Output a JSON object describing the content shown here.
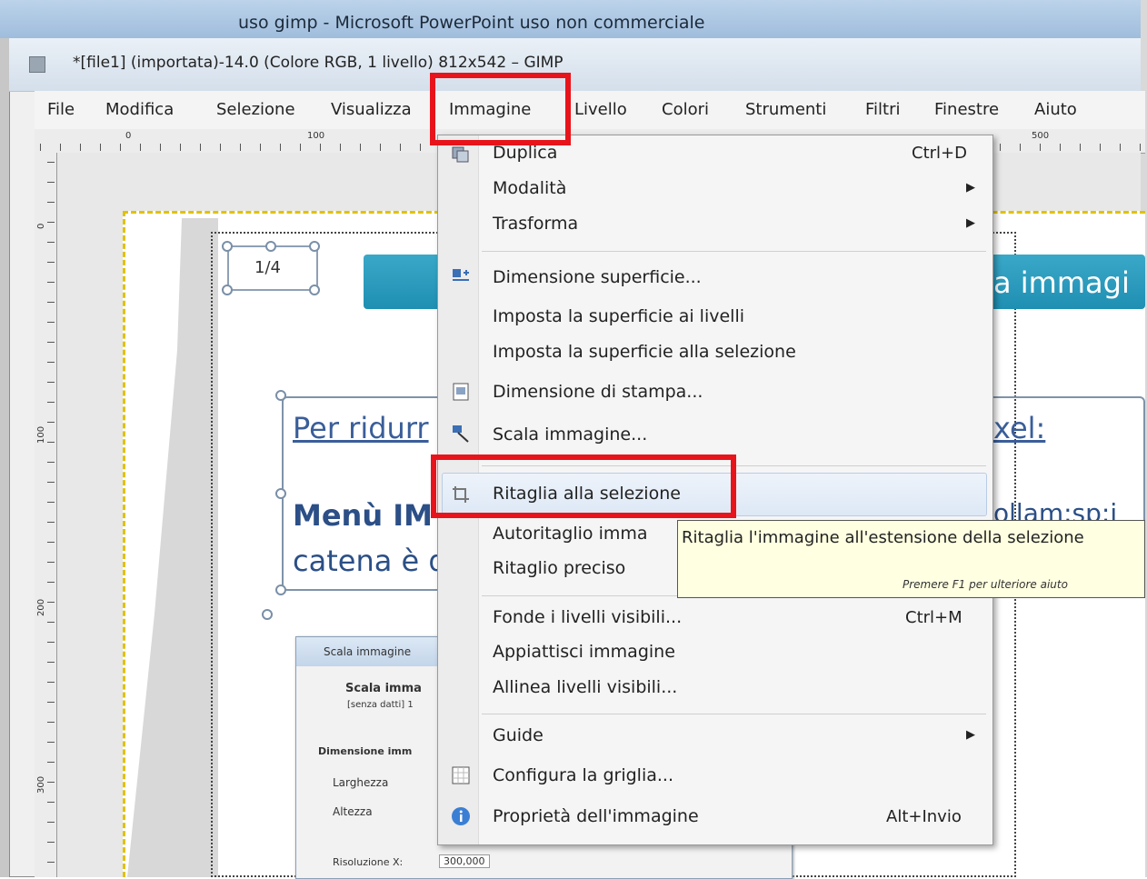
{
  "outer_window": {
    "title": "uso gimp - Microsoft PowerPoint uso non commerciale"
  },
  "gimp_window": {
    "title": "*[file1] (importata)-14.0 (Colore RGB, 1 livello) 812x542 – GIMP"
  },
  "menubar": {
    "items": [
      "File",
      "Modifica",
      "Selezione",
      "Visualizza",
      "Immagine",
      "Livello",
      "Colori",
      "Strumenti",
      "Filtri",
      "Finestre",
      "Aiuto"
    ],
    "active": "Immagine"
  },
  "rulers": {
    "top_labels": [
      "0",
      "100",
      "500"
    ],
    "left_labels": [
      "0",
      "100",
      "200",
      "300"
    ]
  },
  "slide": {
    "page_number": "1/4",
    "title_fragment": "a immagi",
    "line1_start": "Per ridurr",
    "line1_end": "xel:",
    "line2_start": "Menù IM",
    "line2_end": "ollam:sp:i",
    "line3_start": "catena è d"
  },
  "mini_dialog": {
    "title": "Scala immagine",
    "header": "Scala imma",
    "subheader": "[senza datti] 1",
    "section": "Dimensione imm",
    "width_label": "Larghezza",
    "height_label": "Altezza",
    "resolution_label": "Risoluzione X:",
    "resolution_value": "300,000"
  },
  "dropdown": {
    "items": [
      {
        "label": "Duplica",
        "shortcut": "Ctrl+D",
        "submenu": false
      },
      {
        "label": "Modalità",
        "shortcut": "",
        "submenu": true
      },
      {
        "label": "Trasforma",
        "shortcut": "",
        "submenu": true
      },
      {
        "label": "Dimensione superficie...",
        "shortcut": "",
        "submenu": false
      },
      {
        "label": "Imposta la superficie ai livelli",
        "shortcut": "",
        "submenu": false
      },
      {
        "label": "Imposta la superficie alla selezione",
        "shortcut": "",
        "submenu": false
      },
      {
        "label": "Dimensione di stampa...",
        "shortcut": "",
        "submenu": false
      },
      {
        "label": "Scala immagine...",
        "shortcut": "",
        "submenu": false
      },
      {
        "label": "Ritaglia alla selezione",
        "shortcut": "",
        "submenu": false
      },
      {
        "label": "Autoritaglio imma",
        "shortcut": "",
        "submenu": false
      },
      {
        "label": "Ritaglio preciso",
        "shortcut": "",
        "submenu": false
      },
      {
        "label": "Fonde i livelli visibili...",
        "shortcut": "Ctrl+M",
        "submenu": false
      },
      {
        "label": "Appiattisci immagine",
        "shortcut": "",
        "submenu": false
      },
      {
        "label": "Allinea livelli visibili...",
        "shortcut": "",
        "submenu": false
      },
      {
        "label": "Guide",
        "shortcut": "",
        "submenu": true
      },
      {
        "label": "Configura la griglia...",
        "shortcut": "",
        "submenu": false
      },
      {
        "label": "Proprietà dell'immagine",
        "shortcut": "Alt+Invio",
        "submenu": false
      }
    ],
    "highlighted": "Ritaglia alla selezione"
  },
  "tooltip": {
    "text": "Ritaglia l'immagine all'estensione della selezione",
    "hint": "Premere F1 per ulteriore aiuto"
  },
  "colors": {
    "annotation_red": "#e8141b",
    "slide_teal": "#2a9bbd",
    "selection_yellow": "#e0c200",
    "tooltip_bg": "#ffffe1"
  },
  "icons": [
    "duplicate-icon",
    "canvas-size-icon",
    "print-size-icon",
    "scale-icon",
    "crop-icon",
    "grid-icon",
    "info-icon",
    "submenu-arrow-icon"
  ]
}
